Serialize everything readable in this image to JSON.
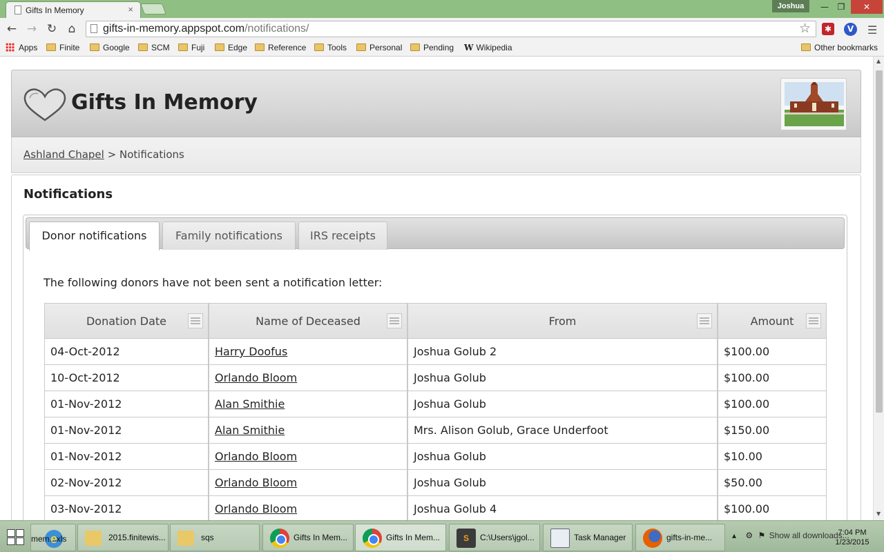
{
  "browser": {
    "tab_title": "Gifts In Memory",
    "user_name": "Joshua",
    "url_domain": "gifts-in-memory.appspot.com",
    "url_path": "/notifications/",
    "bookmarks": [
      "Apps",
      "Finite",
      "Google",
      "SCM",
      "Fuji",
      "Edge",
      "Reference",
      "Tools",
      "Personal",
      "Pending",
      "Wikipedia"
    ],
    "other_bookmarks": "Other bookmarks"
  },
  "site": {
    "title": "Gifts In Memory",
    "breadcrumb_link": "Ashland Chapel",
    "breadcrumb_sep": ">",
    "breadcrumb_current": "Notifications"
  },
  "page": {
    "heading": "Notifications",
    "tabs": [
      "Donor notifications",
      "Family notifications",
      "IRS receipts"
    ],
    "active_tab": "Donor notifications",
    "lead_text": "The following donors have not been sent a notification letter:"
  },
  "table": {
    "headers": [
      "Donation Date",
      "Name of Deceased",
      "From",
      "Amount"
    ],
    "rows": [
      {
        "date": "04-Oct-2012",
        "deceased": "Harry Doofus",
        "from": "Joshua Golub 2",
        "amount": "$100.00"
      },
      {
        "date": "10-Oct-2012",
        "deceased": "Orlando Bloom",
        "from": "Joshua Golub",
        "amount": "$100.00"
      },
      {
        "date": "01-Nov-2012",
        "deceased": "Alan Smithie",
        "from": "Joshua Golub",
        "amount": "$100.00"
      },
      {
        "date": "01-Nov-2012",
        "deceased": "Alan Smithie",
        "from": "Mrs. Alison Golub, Grace Underfoot",
        "amount": "$150.00"
      },
      {
        "date": "01-Nov-2012",
        "deceased": "Orlando Bloom",
        "from": "Joshua Golub",
        "amount": "$10.00"
      },
      {
        "date": "02-Nov-2012",
        "deceased": "Orlando Bloom",
        "from": "Joshua Golub",
        "amount": "$50.00"
      },
      {
        "date": "03-Nov-2012",
        "deceased": "Orlando Bloom",
        "from": "Joshua Golub 4",
        "amount": "$100.00"
      }
    ]
  },
  "taskbar": {
    "items": [
      "mem...xls",
      "2015.finitewis...",
      "sqs",
      "Gifts In Mem...",
      "Gifts In Mem...",
      "C:\\Users\\jgol...",
      "Task Manager",
      "gifts-in-me..."
    ],
    "tray_text": "Show all downloads...",
    "time": "7:04 PM",
    "date": "1/23/2015"
  }
}
